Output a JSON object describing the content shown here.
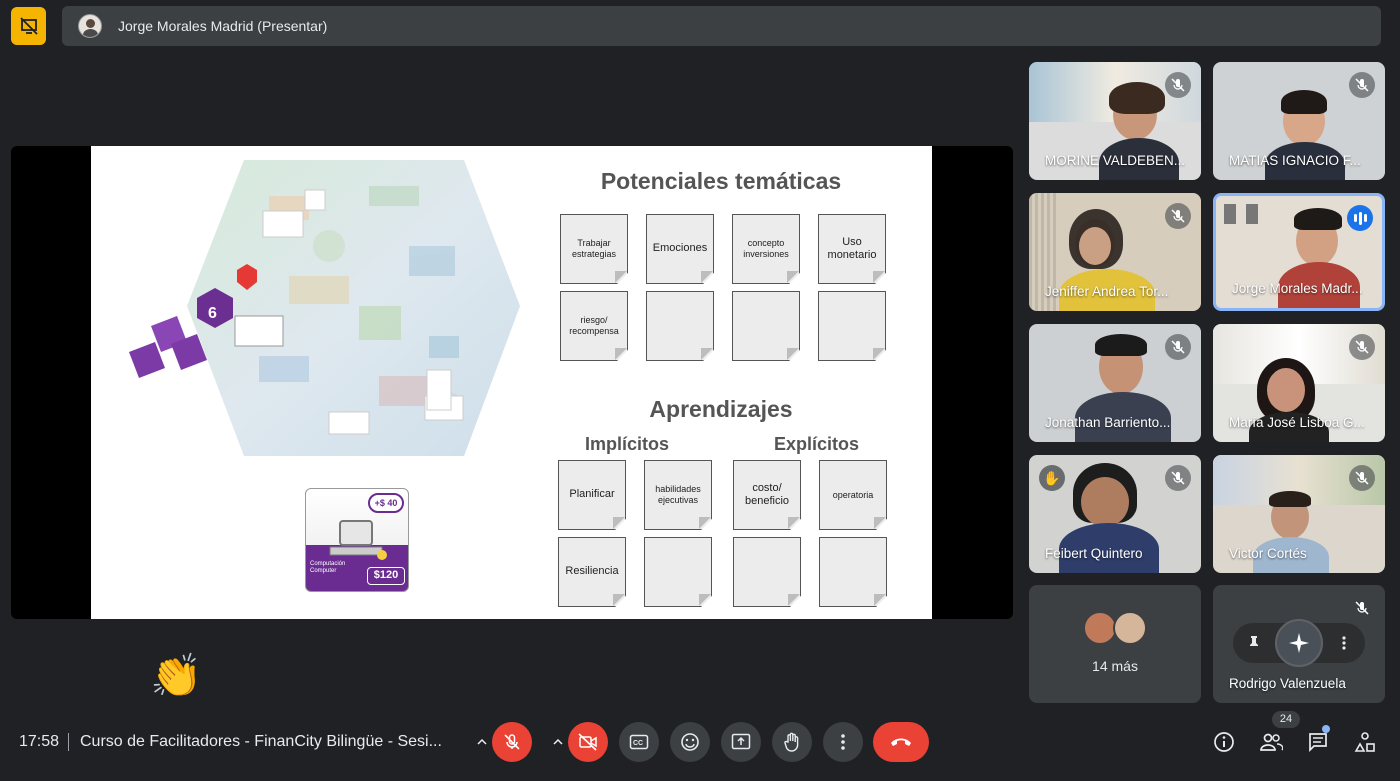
{
  "presenter": {
    "name": "Jorge Morales Madrid (Presentar)"
  },
  "slide": {
    "title": "Potenciales temáticas",
    "notes_top": [
      "Trabajar estrategias",
      "Emociones",
      "concepto inversiones",
      "Uso monetario",
      "riesgo/ recompensa",
      "",
      "",
      ""
    ],
    "learn_title": "Aprendizajes",
    "implicit_label": "Implícitos",
    "explicit_label": "Explícitos",
    "notes_bottom": [
      "Planificar",
      "habilidades ejecutivas",
      "costo/ beneficio",
      "operatoria",
      "Resiliencia",
      "",
      "",
      ""
    ],
    "board_number": "6",
    "card_cost_top": "+$ 40",
    "card_label": "Computación Computer",
    "card_price": "$120"
  },
  "participants": [
    {
      "name": "MORINE VALDEBEN...",
      "muted": true
    },
    {
      "name": "MATIAS IGNACIO F...",
      "muted": true
    },
    {
      "name": "Jeniffer Andrea Tor...",
      "muted": true
    },
    {
      "name": "Jorge Morales Madr...",
      "muted": false,
      "speaking": true
    },
    {
      "name": "Jonathan Barriento...",
      "muted": true
    },
    {
      "name": "María José Lisboa G...",
      "muted": true
    },
    {
      "name": "Feibert Quintero",
      "muted": true,
      "hand": true
    },
    {
      "name": "Victor Cortés",
      "muted": true
    },
    {
      "name": "14 más"
    },
    {
      "name": "Rodrigo Valenzuela",
      "muted": true
    }
  ],
  "reaction_emoji": "👏",
  "bottom": {
    "time": "17:58",
    "meeting_title": "Curso de Facilitadores - FinanCity Bilingüe - Sesi...",
    "people_count": "24"
  },
  "colors": {
    "background": "#202124",
    "surface": "#3c4043",
    "danger": "#ea4335",
    "accent": "#8ab4f8",
    "speaking": "#1a73e8"
  }
}
